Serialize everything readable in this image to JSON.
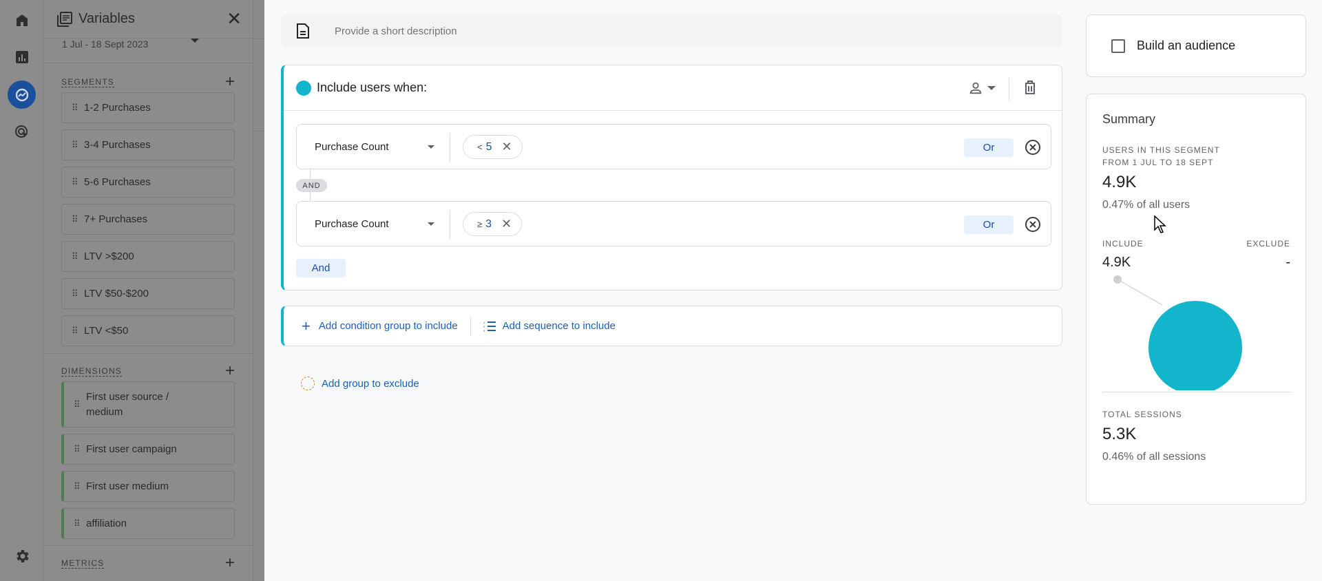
{
  "rail": {
    "items": [
      {
        "name": "home",
        "icon": "home-icon"
      },
      {
        "name": "reports",
        "icon": "bar-chart-icon"
      },
      {
        "name": "explore",
        "icon": "explore-icon",
        "active": true
      },
      {
        "name": "advertising",
        "icon": "target-cursor-icon"
      }
    ],
    "settings_icon": "gear-icon"
  },
  "variables": {
    "title": "Variables",
    "date_range": "1 Jul - 18 Sept 2023",
    "segments": {
      "title": "SEGMENTS",
      "items": [
        "1-2 Purchases",
        "3-4 Purchases",
        "5-6 Purchases",
        "7+ Purchases",
        "LTV >$200",
        "LTV $50-$200",
        "LTV <$50"
      ]
    },
    "dimensions": {
      "title": "DIMENSIONS",
      "items": [
        "First user source / medium",
        "First user campaign",
        "First user medium",
        "affiliation"
      ]
    },
    "metrics": {
      "title": "METRICS"
    }
  },
  "editor": {
    "description_placeholder": "Provide a short description",
    "include_group": {
      "title": "Include users when:",
      "accent": "#12b5cb",
      "conditions": [
        {
          "field": "Purchase Count",
          "operator": "<",
          "value": "5",
          "or_label": "Or"
        },
        {
          "field": "Purchase Count",
          "operator": "≥",
          "value": "3",
          "or_label": "Or"
        }
      ],
      "and_connector": "AND",
      "and_button": "And"
    },
    "add_condition_group": "Add condition group to include",
    "add_sequence": "Add sequence to include",
    "add_exclude": "Add group to exclude"
  },
  "summary": {
    "build_audience_label": "Build an audience",
    "build_audience_checked": false,
    "title": "Summary",
    "users_caption_1": "USERS IN THIS SEGMENT",
    "users_caption_2": "FROM 1 JUL TO 18 SEPT",
    "users_value": "4.9K",
    "users_pct": "0.47% of all users",
    "include_label": "INCLUDE",
    "exclude_label": "EXCLUDE",
    "include_value": "4.9K",
    "exclude_value": "-",
    "sessions_caption": "TOTAL SESSIONS",
    "sessions_value": "5.3K",
    "sessions_pct": "0.46% of all sessions"
  },
  "colors": {
    "accent_teal": "#12b5cb",
    "link_blue": "#1a5fb4",
    "chip_blue_bg": "#e8f0fe",
    "dimension_green": "#4f7d4f",
    "exclude_orange": "#e07b1a"
  }
}
